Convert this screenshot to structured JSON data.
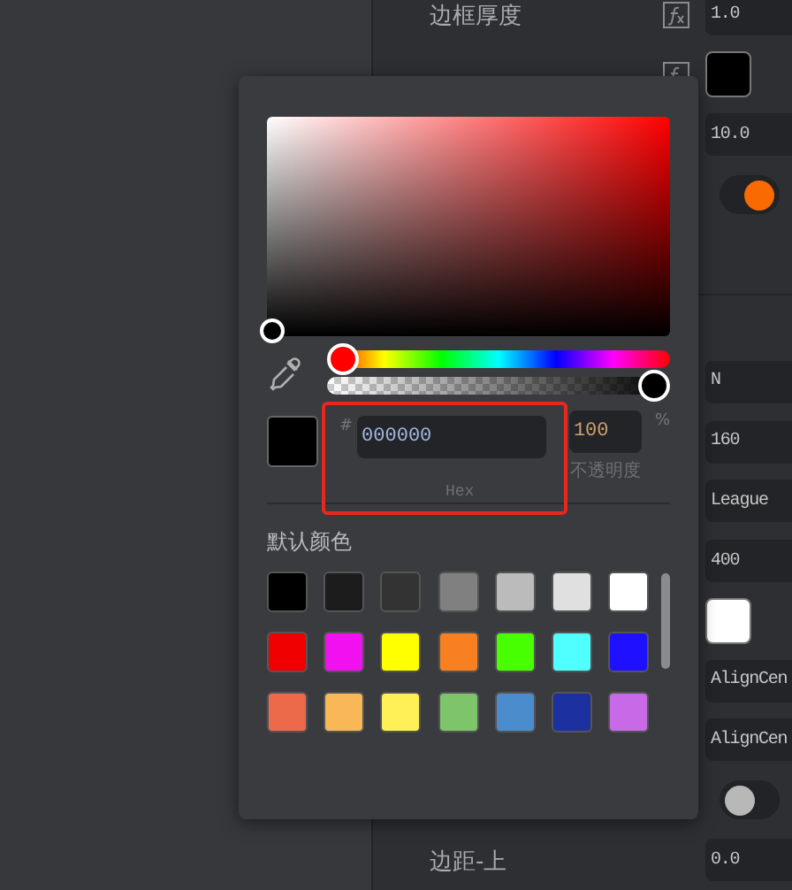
{
  "properties": [
    {
      "kind": "field",
      "label": "边框厚度",
      "fx": true,
      "value": "1.0"
    },
    {
      "kind": "swatch",
      "fx": true,
      "color": "#000000"
    },
    {
      "kind": "field",
      "value": "10.0"
    },
    {
      "kind": "toggle",
      "on": true
    },
    {
      "kind": "divider"
    },
    {
      "kind": "field",
      "value": "N"
    },
    {
      "kind": "field",
      "value": "160"
    },
    {
      "kind": "field",
      "value": "League"
    },
    {
      "kind": "field",
      "value": "400"
    },
    {
      "kind": "swatch",
      "color": "#ffffff"
    },
    {
      "kind": "field",
      "value": "AlignCen"
    },
    {
      "kind": "field",
      "value": "AlignCen"
    },
    {
      "kind": "toggle",
      "on": false
    },
    {
      "kind": "field",
      "label": "边距-上",
      "value": "0.0"
    }
  ],
  "color_picker": {
    "hue_slider": {
      "level": 0
    },
    "alpha_slider": {
      "level": 1
    },
    "hash": "#",
    "hex": "000000",
    "hex_label": "Hex",
    "opacity": "100",
    "percent": "%",
    "opacity_label": "不透明度",
    "highlighted": true,
    "presets_title": "默认颜色",
    "presets": [
      {
        "color": "#000000"
      },
      {
        "color": "#1c1c1c"
      },
      {
        "color": "#333333"
      },
      {
        "color": "#808080"
      },
      {
        "color": "#bbbbbb"
      },
      {
        "color": "#e0e0e0"
      },
      {
        "color": "#ffffff"
      },
      {
        "color": "#f00000"
      },
      {
        "color": "#f010f0"
      },
      {
        "color": "#ffff00"
      },
      {
        "color": "#f88020"
      },
      {
        "color": "#48ff00"
      },
      {
        "color": "#50ffff"
      },
      {
        "color": "#1f10ff"
      },
      {
        "color": "#ec6a4a"
      },
      {
        "color": "#f8b858"
      },
      {
        "color": "#fff058"
      },
      {
        "color": "#7ec46a"
      },
      {
        "color": "#4a8ccc"
      },
      {
        "color": "#1c30a0"
      },
      {
        "color": "#c86ae8"
      }
    ]
  }
}
